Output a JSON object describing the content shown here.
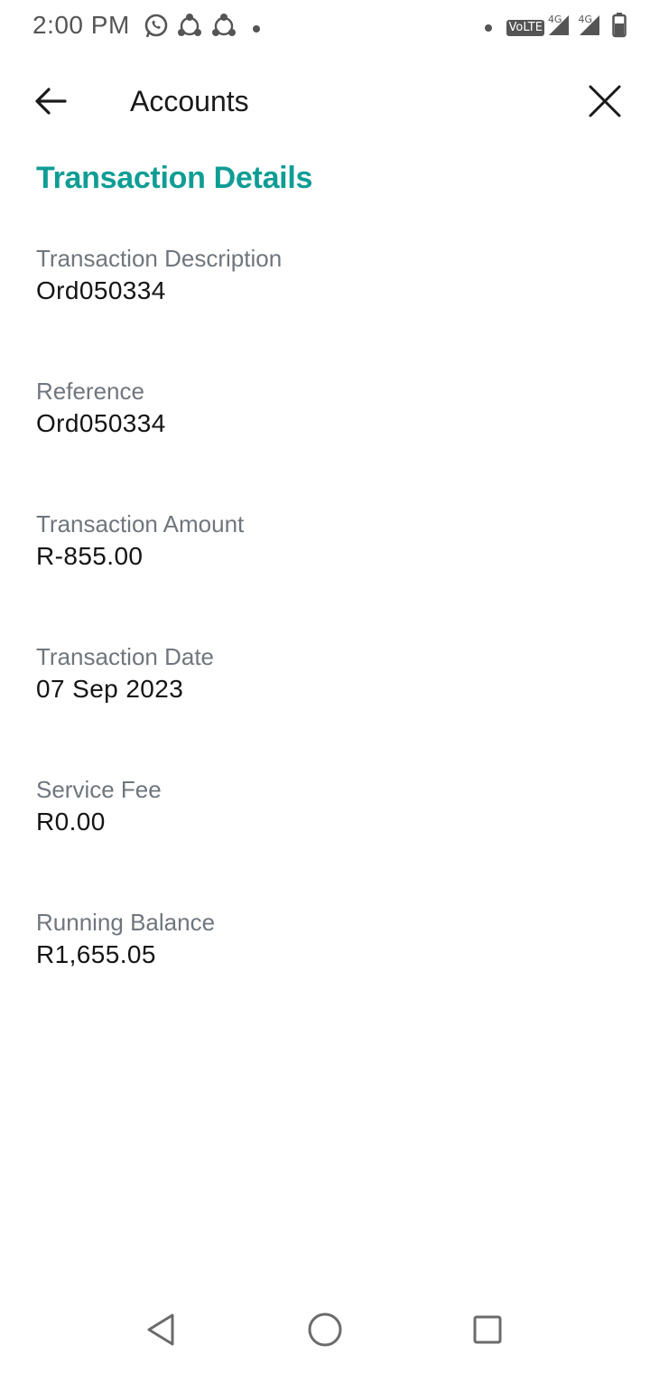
{
  "status_bar": {
    "time": "2:00 PM",
    "volte": "VoLTE",
    "network_1": "4G",
    "network_2": "4G",
    "left_icons": [
      "whatsapp-icon",
      "share-icon",
      "share-icon",
      "notification-dot"
    ],
    "right_icons": [
      "notification-dot",
      "volte-badge",
      "signal-icon",
      "signal-icon",
      "battery-icon"
    ]
  },
  "header": {
    "title": "Accounts",
    "back_icon": "arrow-left-icon",
    "close_icon": "close-icon"
  },
  "section": {
    "title": "Transaction Details"
  },
  "details": [
    {
      "label": "Transaction Description",
      "value": "Ord050334"
    },
    {
      "label": "Reference",
      "value": "Ord050334"
    },
    {
      "label": "Transaction Amount",
      "value": "R-855.00"
    },
    {
      "label": "Transaction Date",
      "value": "07 Sep 2023"
    },
    {
      "label": "Service Fee",
      "value": "R0.00"
    },
    {
      "label": "Running Balance",
      "value": "R1,655.05"
    }
  ],
  "nav_bar": {
    "icons": [
      "back-triangle-icon",
      "home-circle-icon",
      "recents-square-icon"
    ]
  },
  "colors": {
    "accent": "#0e9d95",
    "label": "#6f767d",
    "value": "#141414",
    "status": "#555555"
  }
}
